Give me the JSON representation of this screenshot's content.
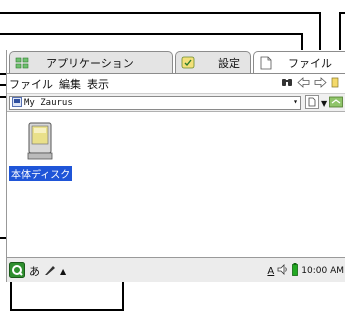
{
  "tabs": [
    {
      "label": "アプリケーション",
      "icon": "applications-grid-icon",
      "active": false
    },
    {
      "label": "設定",
      "icon": "settings-icon",
      "active": false
    },
    {
      "label": "ファイル",
      "icon": "file-icon",
      "active": true
    }
  ],
  "menu": {
    "items": [
      "ファイル",
      "編集",
      "表示"
    ],
    "icons": [
      "binoculars-icon",
      "back-arrow-icon",
      "forward-arrow-icon",
      "up-folder-icon"
    ]
  },
  "pathbar": {
    "value": "My Zaurus",
    "icons": [
      "zaurus-device-icon",
      "dropdown-arrow-icon",
      "view-page-icon",
      "view-dropdown-icon",
      "directory-up-icon"
    ]
  },
  "files": [
    {
      "label": "本体ディスク",
      "icon": "internal-disk-icon",
      "selected": true
    }
  ],
  "taskbar": {
    "left_icons": [
      "launcher-q-icon",
      "input-method-icon",
      "pen-icon",
      "up-triangle-icon"
    ],
    "input_mode": "あ",
    "indicator": "A",
    "time": "10:00 AM",
    "right_icons": [
      "speaker-icon",
      "battery-icon"
    ]
  },
  "colors": {
    "selection": "#1f55d8",
    "tab_active": "#ffffff",
    "tab_inactive": "#e4e4e4",
    "taskbar": "#ececec",
    "battery": "#22a822"
  }
}
